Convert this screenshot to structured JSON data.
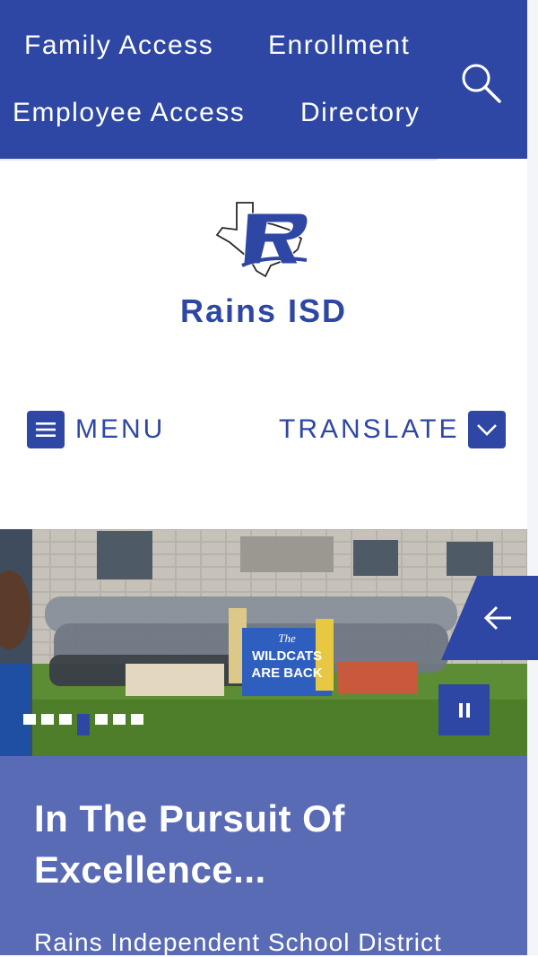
{
  "top_nav": {
    "links": [
      "Family Access",
      "Enrollment",
      "Employee Access",
      "Directory"
    ],
    "search_icon": "search-icon"
  },
  "site": {
    "name": "Rains ISD",
    "logo_icon": "texas-r-logo"
  },
  "controls": {
    "menu_label": "MENU",
    "translate_label": "TRANSLATE"
  },
  "carousel": {
    "slide_count": 7,
    "active_slide": 4,
    "prev_icon": "arrow-left-icon",
    "pause_icon": "pause-icon",
    "photo_signs": [
      "The",
      "WILDCATS",
      "ARE BACK"
    ]
  },
  "hero_text": {
    "headline": "In The Pursuit Of Excellence...",
    "subtext": "Rains Independent School District"
  },
  "colors": {
    "brand_blue": "#2e47a4",
    "headline_box": "#5a6bb5",
    "white": "#ffffff"
  }
}
